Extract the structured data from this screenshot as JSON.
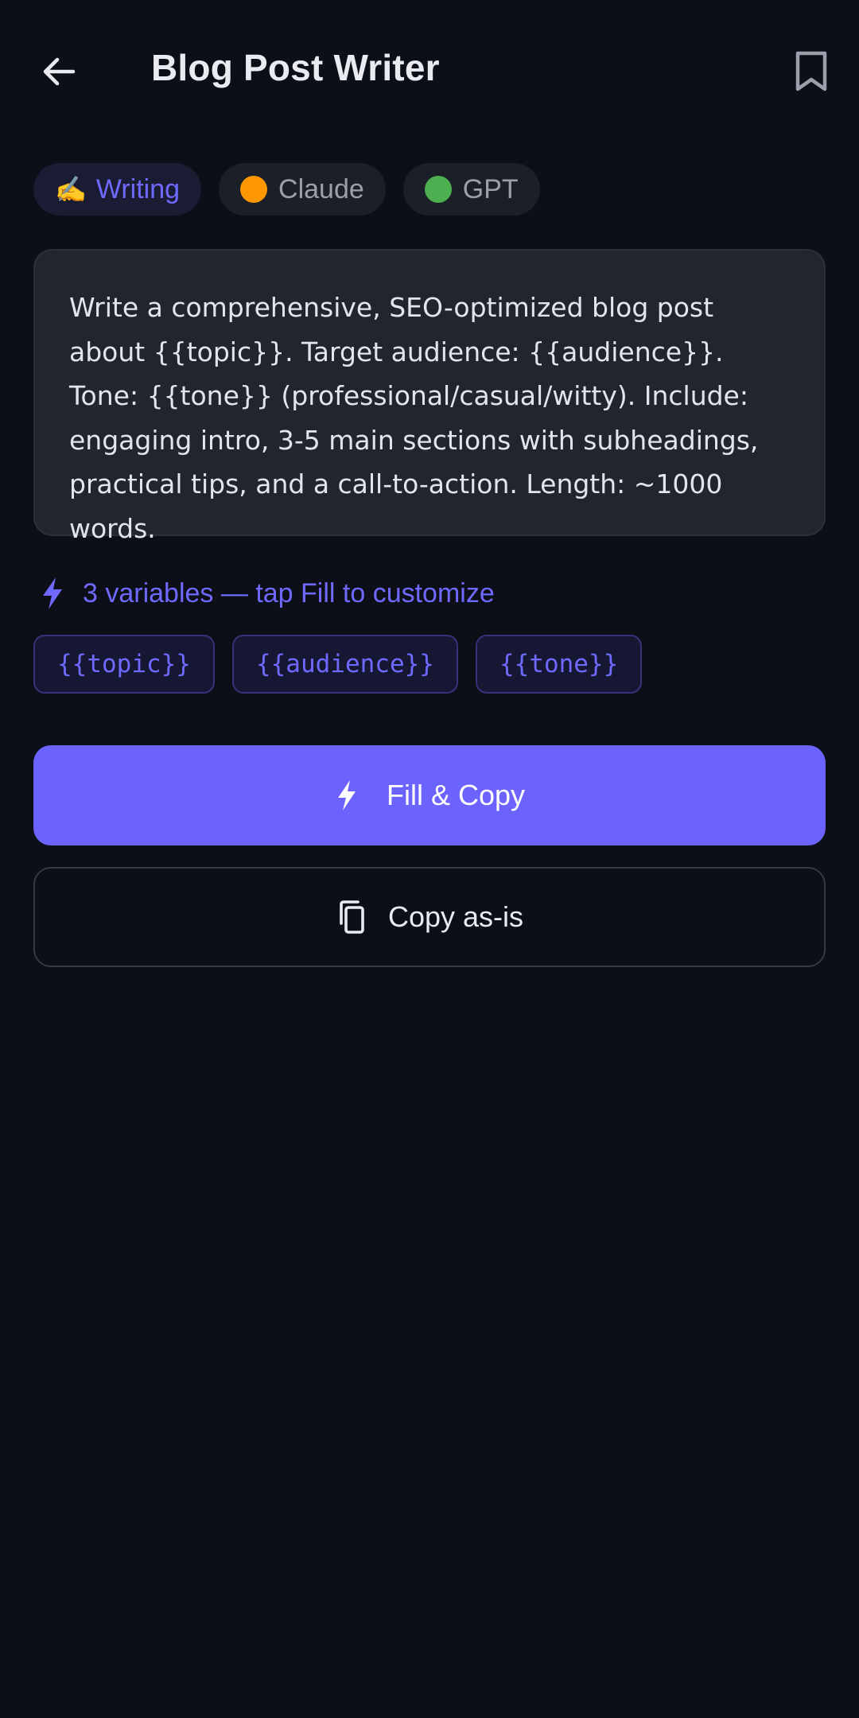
{
  "header": {
    "title": "Blog Post Writer"
  },
  "chips": [
    {
      "emoji": "✍️",
      "label": "Writing",
      "active": true
    },
    {
      "label": "Claude",
      "dot_color": "#ff9800"
    },
    {
      "label": "GPT",
      "dot_color": "#4caf50"
    }
  ],
  "prompt": {
    "text": "Write a comprehensive, SEO-optimized blog post about {{topic}}. Target audience: {{audience}}. Tone: {{tone}} (professional/casual/witty). Include: engaging intro, 3-5 main sections with subheadings, practical tips, and a call-to-action. Length: ~1000 words."
  },
  "variables": {
    "info": "3 variables — tap Fill to customize",
    "tags": [
      "{{topic}}",
      "{{audience}}",
      "{{tone}}"
    ]
  },
  "actions": {
    "fill_copy_label": "Fill & Copy",
    "copy_as_is_label": "Copy as-is"
  },
  "colors": {
    "background": "#0c0f17",
    "accent": "#6c63ff",
    "card": "#21252e"
  },
  "icons": {
    "back": "arrow-left-icon",
    "bookmark": "bookmark-icon",
    "bolt": "bolt-icon",
    "copy": "copy-icon"
  }
}
